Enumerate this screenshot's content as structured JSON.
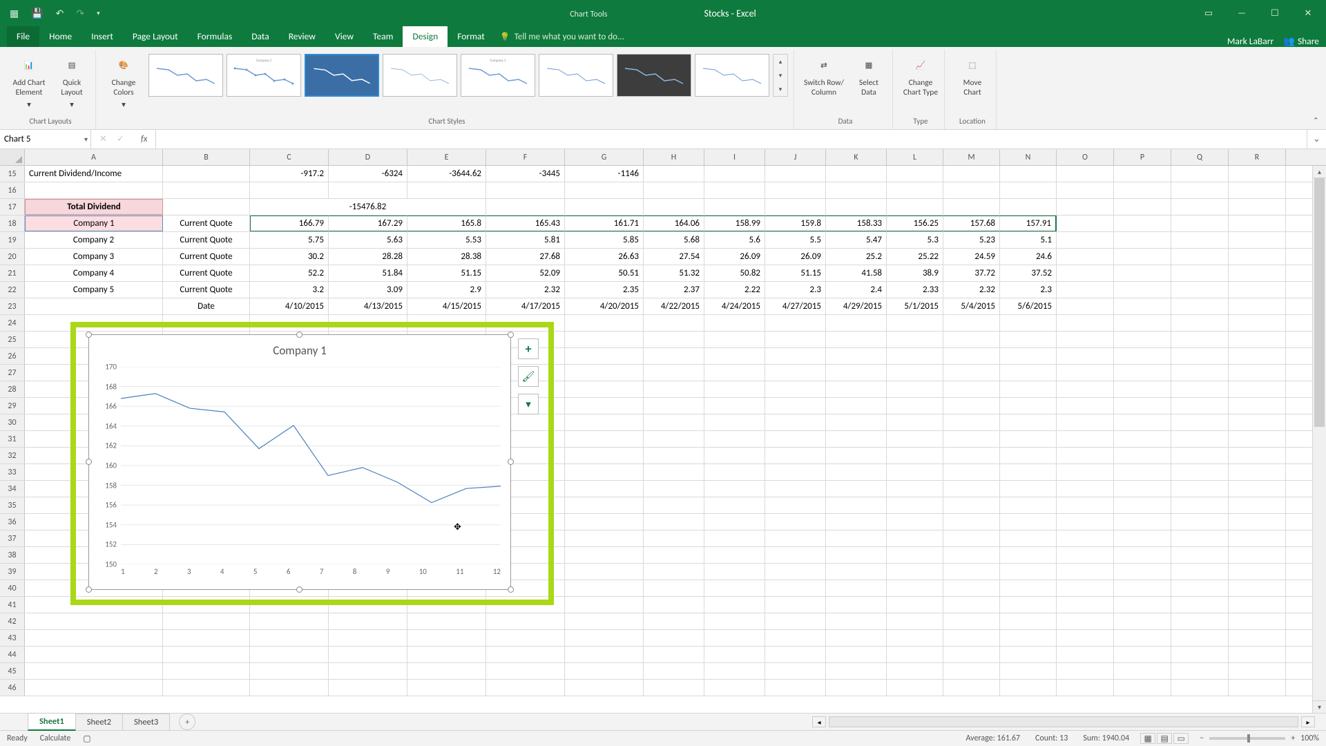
{
  "titlebar": {
    "chart_tools_label": "Chart Tools",
    "app_title": "Stocks - Excel"
  },
  "tabs": {
    "file": "File",
    "home": "Home",
    "insert": "Insert",
    "page_layout": "Page Layout",
    "formulas": "Formulas",
    "data": "Data",
    "review": "Review",
    "view": "View",
    "team": "Team",
    "design": "Design",
    "format": "Format",
    "tell_me": "Tell me what you want to do...",
    "username": "Mark LaBarr",
    "share": "Share"
  },
  "ribbon": {
    "add_chart_element": "Add Chart\nElement",
    "quick_layout": "Quick\nLayout",
    "change_colors": "Change\nColors",
    "chart_layouts_label": "Chart Layouts",
    "chart_styles_label": "Chart Styles",
    "switch_row_col": "Switch Row/\nColumn",
    "select_data": "Select\nData",
    "data_label": "Data",
    "change_chart_type": "Change\nChart Type",
    "type_label": "Type",
    "move_chart": "Move\nChart",
    "location_label": "Location"
  },
  "namebox": {
    "value": "Chart 5",
    "fx_label": "fx"
  },
  "columns": [
    "A",
    "B",
    "C",
    "D",
    "E",
    "F",
    "G",
    "H",
    "I",
    "J",
    "K",
    "L",
    "M",
    "N",
    "O",
    "P",
    "Q",
    "R"
  ],
  "rows_start": 15,
  "sheet": {
    "r15": {
      "A": "Current Dividend/Income",
      "C": "-917.2",
      "D": "-6324",
      "E": "-3644.62",
      "F": "-3445",
      "G": "-1146"
    },
    "r17": {
      "A": "Total Dividend",
      "E": "-15476.82"
    },
    "r18": {
      "A": "Company 1",
      "B": "Current Quote",
      "vals": [
        "166.79",
        "167.29",
        "165.8",
        "165.43",
        "161.71",
        "164.06",
        "158.99",
        "159.8",
        "158.33",
        "156.25",
        "157.68",
        "157.91"
      ]
    },
    "r19": {
      "A": "Company 2",
      "B": "Current Quote",
      "vals": [
        "5.75",
        "5.63",
        "5.53",
        "5.81",
        "5.85",
        "5.68",
        "5.6",
        "5.5",
        "5.47",
        "5.3",
        "5.23",
        "5.1"
      ]
    },
    "r20": {
      "A": "Company 3",
      "B": "Current Quote",
      "vals": [
        "30.2",
        "28.28",
        "28.38",
        "27.68",
        "26.63",
        "27.54",
        "26.09",
        "26.09",
        "25.2",
        "25.22",
        "24.59",
        "24.6"
      ]
    },
    "r21": {
      "A": "Company 4",
      "B": "Current Quote",
      "vals": [
        "52.2",
        "51.84",
        "51.15",
        "52.09",
        "50.51",
        "51.32",
        "50.82",
        "51.15",
        "41.58",
        "38.9",
        "37.72",
        "37.52"
      ]
    },
    "r22": {
      "A": "Company 5",
      "B": "Current Quote",
      "vals": [
        "3.2",
        "3.09",
        "2.9",
        "2.32",
        "2.35",
        "2.37",
        "2.22",
        "2.3",
        "2.4",
        "2.33",
        "2.32",
        "2.3"
      ]
    },
    "r23": {
      "B": "Date",
      "vals": [
        "4/10/2015",
        "4/13/2015",
        "4/15/2015",
        "4/17/2015",
        "4/20/2015",
        "4/22/2015",
        "4/24/2015",
        "4/27/2015",
        "4/29/2015",
        "5/1/2015",
        "5/4/2015",
        "5/6/2015"
      ]
    }
  },
  "chart_data": {
    "type": "line",
    "title": "Company 1",
    "xlabel": "",
    "ylabel": "",
    "x": [
      1,
      2,
      3,
      4,
      5,
      6,
      7,
      8,
      9,
      10,
      11,
      12
    ],
    "values": [
      166.79,
      167.29,
      165.8,
      165.43,
      161.71,
      164.06,
      158.99,
      159.8,
      158.33,
      156.25,
      157.68,
      157.91
    ],
    "ylim": [
      150,
      170
    ],
    "yticks": [
      150,
      152,
      154,
      156,
      158,
      160,
      162,
      164,
      166,
      168,
      170
    ]
  },
  "sheettabs": {
    "tabs": [
      "Sheet1",
      "Sheet2",
      "Sheet3"
    ],
    "active": 0
  },
  "statusbar": {
    "ready": "Ready",
    "calculate": "Calculate",
    "average": "Average: 161.67",
    "count": "Count: 13",
    "sum": "Sum: 1940.04",
    "zoom": "100%"
  }
}
